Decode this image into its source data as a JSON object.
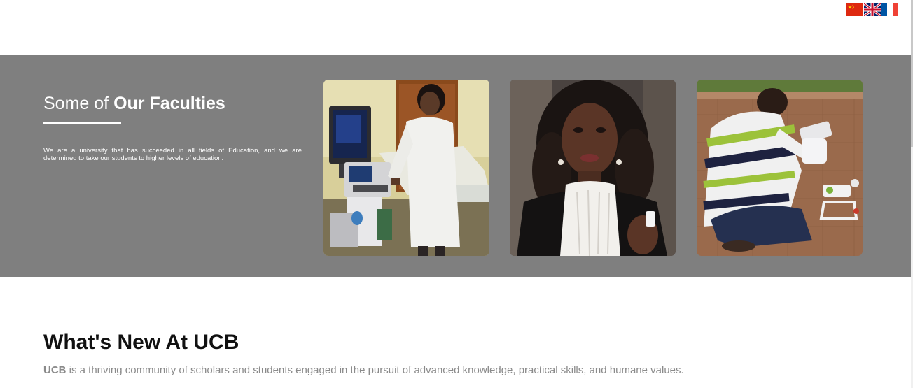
{
  "language_flags": [
    {
      "name": "Chinese",
      "icon": "china-flag-icon"
    },
    {
      "name": "English",
      "icon": "uk-flag-icon"
    },
    {
      "name": "French",
      "icon": "france-flag-icon"
    }
  ],
  "faculties": {
    "heading_prefix": "Some of ",
    "heading_bold": "Our Faculties",
    "description": "We are a university that has succeeded in all fields of Education, and we are determined to take our students to higher levels of education.",
    "background_color": "#7f7f7f",
    "cards": [
      {
        "image": "faculty-medical-ultrasound-photo"
      },
      {
        "image": "faculty-law-graduate-photo"
      },
      {
        "image": "faculty-engineering-drone-photo"
      }
    ]
  },
  "news": {
    "title": "What's New At UCB",
    "subtitle_bold": "UCB",
    "subtitle_rest": " is a thriving community of scholars and students engaged in the pursuit of advanced knowledge, practical skills, and humane values."
  }
}
